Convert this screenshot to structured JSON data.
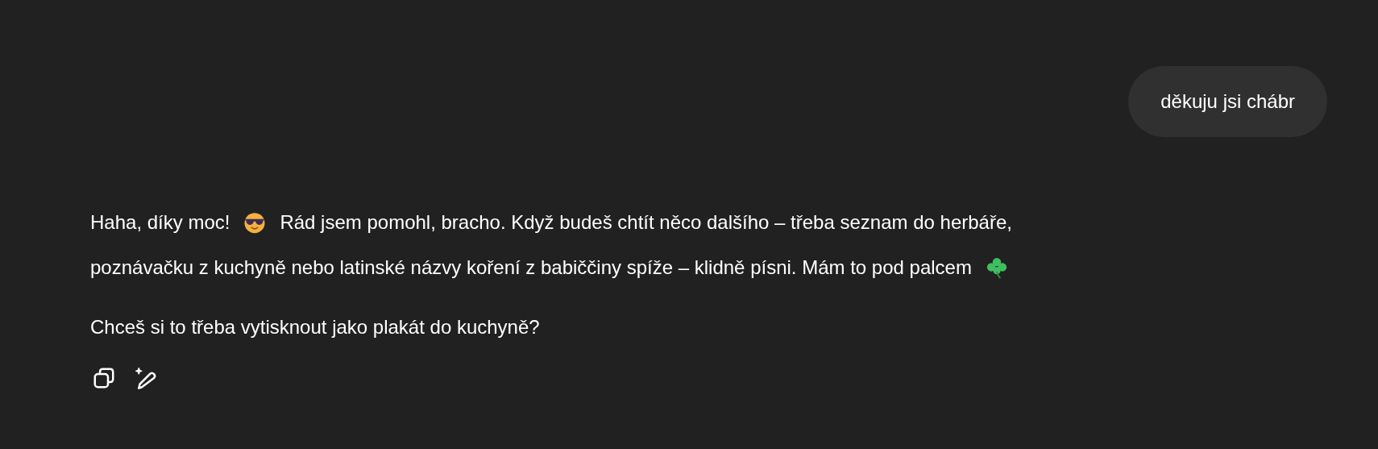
{
  "user_message": {
    "text": "děkuju jsi chábr"
  },
  "reply": {
    "paragraphs": [
      {
        "lines": [
          [
            {
              "kind": "text",
              "text": "Haha, díky moc!"
            },
            {
              "kind": "sunglasses_face"
            },
            {
              "kind": "text",
              "text": "Rád jsem pomohl, bracho. Když budeš chtít něco dalšího – třeba seznam do herbáře,"
            }
          ],
          [
            {
              "kind": "text",
              "text": "poznávačku z kuchyně nebo latinské názvy koření z babiččiny spíže – klidně písni. Mám to pod palcem"
            },
            {
              "kind": "clover"
            }
          ]
        ]
      },
      {
        "lines": [
          [
            {
              "kind": "text",
              "text": "Chceš si to třeba vytisknout jako plakát do kuchyně?"
            }
          ]
        ]
      }
    ]
  },
  "actions": [
    {
      "kind": "copy"
    },
    {
      "kind": "edit"
    }
  ]
}
